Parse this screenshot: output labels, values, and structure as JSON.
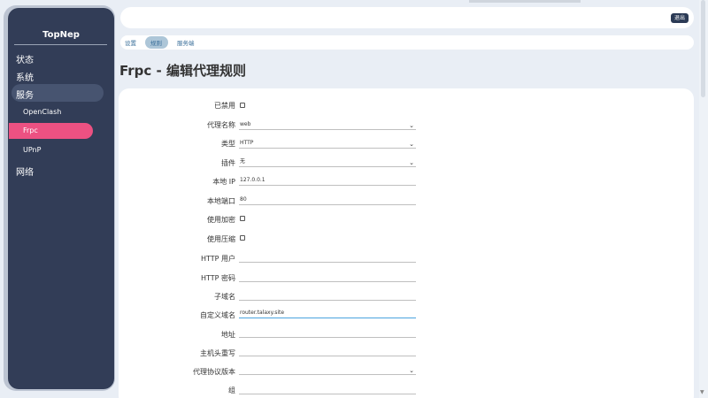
{
  "sidebar": {
    "brand": "TopNep",
    "menu": [
      "状态",
      "系统",
      "服务",
      "OpenClash",
      "Frpc",
      "UPnP",
      "网络"
    ]
  },
  "topbar": {
    "logout": "退出"
  },
  "tabs": [
    "设置",
    "规则",
    "服务端"
  ],
  "page_title": "Frpc - 编辑代理规则",
  "form": {
    "labels": [
      "已禁用",
      "代理名称",
      "类型",
      "插件",
      "本地 IP",
      "本地端口",
      "使用加密",
      "使用压缩",
      "HTTP 用户",
      "HTTP 密码",
      "子域名",
      "自定义域名",
      "地址",
      "主机头重写",
      "代理协议版本",
      "组"
    ],
    "values": {
      "proxy_name": "web",
      "type": "HTTP",
      "plugin": "无",
      "local_ip": "127.0.0.1",
      "local_port": "80",
      "custom_domain": "router.talaxy.site"
    }
  }
}
